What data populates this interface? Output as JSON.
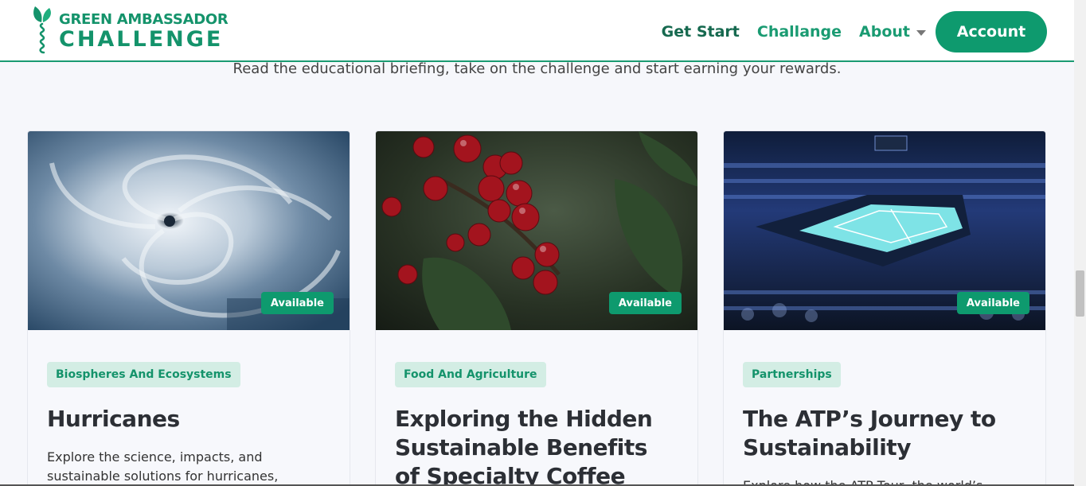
{
  "brand": {
    "line1": "GREEN AMBASSADOR",
    "line2": "CHALLENGE",
    "color": "#14936b"
  },
  "nav": {
    "get_start": "Get Start",
    "challange": "Challange",
    "about": "About",
    "account": "Account"
  },
  "intro": "Read the educational briefing, take on the challenge and start earning your rewards.",
  "cards": [
    {
      "image": "hurricane-satellite-image",
      "badge": "Available",
      "tag": "Biospheres And Ecosystems",
      "title": "Hurricanes",
      "desc": "Explore the science, impacts, and sustainable solutions for hurricanes,"
    },
    {
      "image": "coffee-cherries-image",
      "badge": "Available",
      "tag": "Food And Agriculture",
      "title": "Exploring the Hidden Sustainable Benefits of Specialty Coffee",
      "desc": ""
    },
    {
      "image": "tennis-arena-image",
      "badge": "Available",
      "tag": "Partnerships",
      "title": "The ATP’s Journey to Sustainability",
      "desc": "Explore how the ATP Tour, the world’s"
    }
  ],
  "colors": {
    "accent": "#0e9a6e",
    "tag_bg": "#d3ede4",
    "dark_green": "#16694f"
  }
}
